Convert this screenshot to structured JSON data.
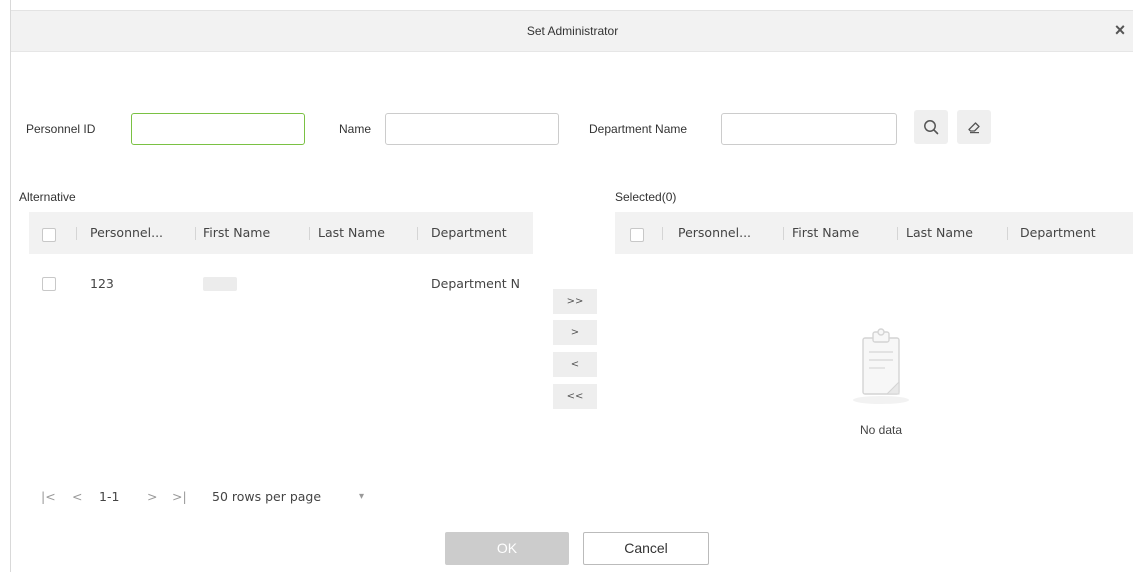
{
  "dialog": {
    "title": "Set Administrator",
    "close_glyph": "×"
  },
  "filters": {
    "personnel_id": {
      "label": "Personnel ID",
      "value": ""
    },
    "name": {
      "label": "Name",
      "value": ""
    },
    "department_name": {
      "label": "Department Name",
      "value": ""
    },
    "search_icon": "search-icon",
    "clear_icon": "eraser-icon"
  },
  "alternative": {
    "label": "Alternative",
    "columns": [
      "Personnel...",
      "First Name",
      "Last Name",
      "Department"
    ],
    "rows": [
      {
        "personnel_id": "123",
        "first_name": "",
        "last_name": "",
        "department": "Department N"
      }
    ]
  },
  "selected": {
    "label": "Selected(0)",
    "columns": [
      "Personnel...",
      "First Name",
      "Last Name",
      "Department"
    ],
    "empty_text": "No data"
  },
  "transfer_buttons": {
    "move_all_right": ">>",
    "move_right": ">",
    "move_left": "<",
    "move_all_left": "<<"
  },
  "pagination": {
    "first": "|<",
    "prev": "<",
    "range": "1-1",
    "next": ">",
    "last": ">|",
    "rows_per_page": "50 rows per page",
    "dropdown_glyph": "▾"
  },
  "footer": {
    "ok_label": "OK",
    "cancel_label": "Cancel"
  },
  "colors": {
    "focus_border": "#7ac143",
    "header_bg": "#f2f2f2",
    "ok_disabled_bg": "#cccccc"
  }
}
